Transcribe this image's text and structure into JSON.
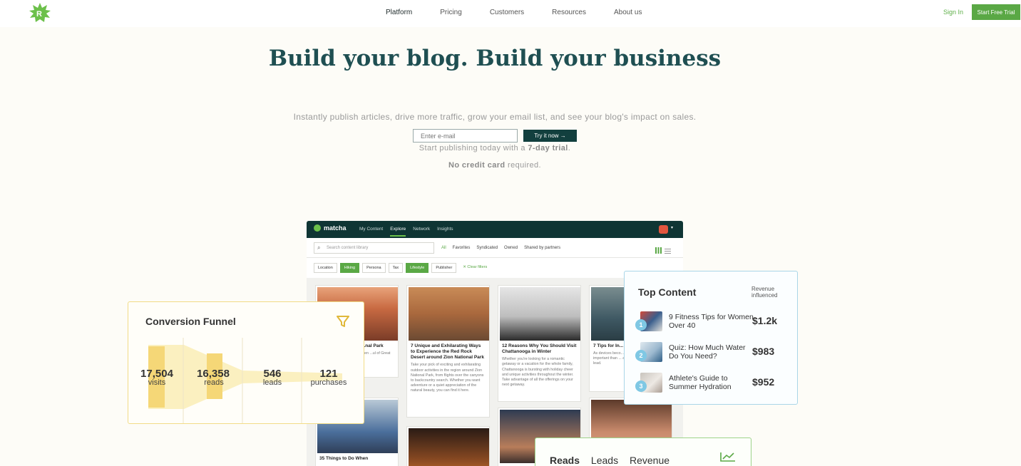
{
  "nav": {
    "links": [
      "Platform",
      "Pricing",
      "Customers",
      "Resources",
      "About us"
    ],
    "signin": "Sign In",
    "cta": "Start Free Trial"
  },
  "hero": {
    "title": "Build your blog. Build your business",
    "subtitle": "Instantly publish articles, drive more traffic, grow your email list, and see your blog's impact on sales.",
    "email_placeholder": "Enter e-mail",
    "try_button": "Try it now →",
    "trial_pre": "Start publishing today with a ",
    "trial_bold": "7-day trial",
    "trial_post": ".",
    "cc_bold": "No credit card",
    "cc_post": " required."
  },
  "app": {
    "logo": "matcha",
    "nav": [
      "My Content",
      "Explore",
      "Network",
      "Insights"
    ],
    "search_placeholder": "Search content library",
    "filters": [
      "All",
      "Favorites",
      "Syndicated",
      "Owned",
      "Shared by partners"
    ],
    "chips": [
      "Location",
      "Hiking",
      "Persona",
      "Tax",
      "Lifestyle",
      "Publisher"
    ],
    "clear_filters": "✕ Clear filters",
    "cards": [
      {
        "title": "...w Before ...Great ...nal Park",
        "text": "...ving the land ...ands, assen ...ul of Great Sand"
      },
      {
        "title": "7 Unique and Exhilarating Ways to Experience the Red Rock Desert around Zion National Park",
        "text": "Take your pick of exciting and exhilarating outdoor activities in the region around Zion National Park, from flights over the canyons to backcountry search. Whether you want adventure or a quiet appreciation of the natural beauty, you can find it here."
      },
      {
        "title": "12 Reasons Why You Should Visit Chattanooga in Winter",
        "text": "Whether you're looking for a romantic getaway or a vacation for the whole family, Chattanooga is bursting with holiday cheer and unique activities throughout the winter. Take advantage of all the offerings on your next getaway."
      },
      {
        "title": "7 Tips for In... to Outdoor A...",
        "text": "As devices beco... one's child's de... important than ... actively a regula... we lead."
      },
      {
        "title": "35 Things to Do When",
        "text": ""
      }
    ]
  },
  "funnel": {
    "title": "Conversion Funnel",
    "stages": [
      {
        "value": "17,504",
        "label": "visits"
      },
      {
        "value": "16,358",
        "label": "reads"
      },
      {
        "value": "546",
        "label": "leads"
      },
      {
        "value": "121",
        "label": "purchases"
      }
    ]
  },
  "top_content": {
    "title": "Top Content",
    "revenue_label": "Revenue influenced",
    "items": [
      {
        "rank": "1",
        "name": "9 Fitness Tips for Women Over 40",
        "value": "$1.2k"
      },
      {
        "rank": "2",
        "name": "Quiz: How Much Water Do You Need?",
        "value": "$983"
      },
      {
        "rank": "3",
        "name": "Athlete's Guide to Summer Hydration",
        "value": "$952"
      }
    ]
  },
  "reads_panel": {
    "tabs": [
      "Reads",
      "Leads",
      "Revenue"
    ]
  },
  "colors": {
    "brand_green": "#5aa845",
    "dark_teal": "#123f3e",
    "title_teal": "#1f4f52",
    "funnel_yellow": "#f2dc87",
    "top_blue": "#a9d6e8"
  }
}
